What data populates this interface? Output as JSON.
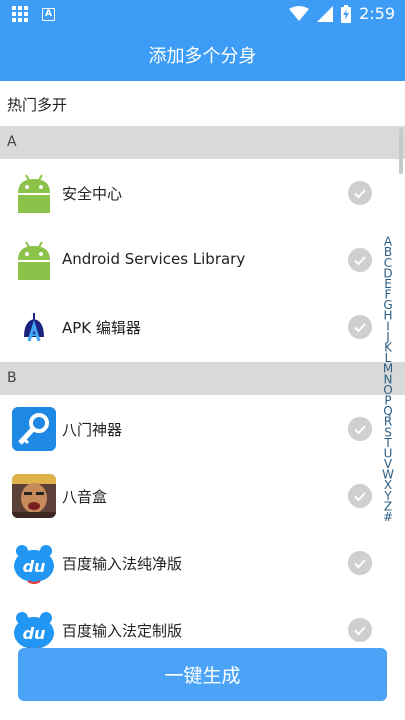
{
  "status_bar": {
    "time": "2:59",
    "left_icons": [
      "grid-icon",
      "a-icon"
    ],
    "right_icons": [
      "wifi-icon",
      "signal-icon",
      "battery-charging-icon"
    ]
  },
  "header": {
    "title": "添加多个分身"
  },
  "hot_section": {
    "label": "热门多开"
  },
  "sections": [
    {
      "letter": "A",
      "apps": [
        {
          "name": "安全中心",
          "icon": "android-robot-icon"
        },
        {
          "name": "Android Services Library",
          "icon": "android-robot-icon"
        },
        {
          "name": "APK 编辑器",
          "icon": "apk-editor-icon"
        }
      ]
    },
    {
      "letter": "B",
      "apps": [
        {
          "name": "八门神器",
          "icon": "key-icon"
        },
        {
          "name": "八音盒",
          "icon": "music-box-portrait-icon"
        },
        {
          "name": "百度输入法纯净版",
          "icon": "baidu-du-icon"
        },
        {
          "name": "百度输入法定制版",
          "icon": "baidu-du-icon"
        }
      ]
    }
  ],
  "index_letters": [
    "A",
    "B",
    "C",
    "D",
    "E",
    "F",
    "G",
    "H",
    "I",
    "J",
    "K",
    "L",
    "M",
    "N",
    "O",
    "P",
    "Q",
    "R",
    "S",
    "T",
    "U",
    "V",
    "W",
    "X",
    "Y",
    "Z",
    "#"
  ],
  "footer": {
    "button_label": "一键生成"
  },
  "colors": {
    "primary": "#3d9cf5",
    "button": "#4aa3f7",
    "section_bg": "#d9d9d9",
    "check": "#cfcfcf"
  }
}
